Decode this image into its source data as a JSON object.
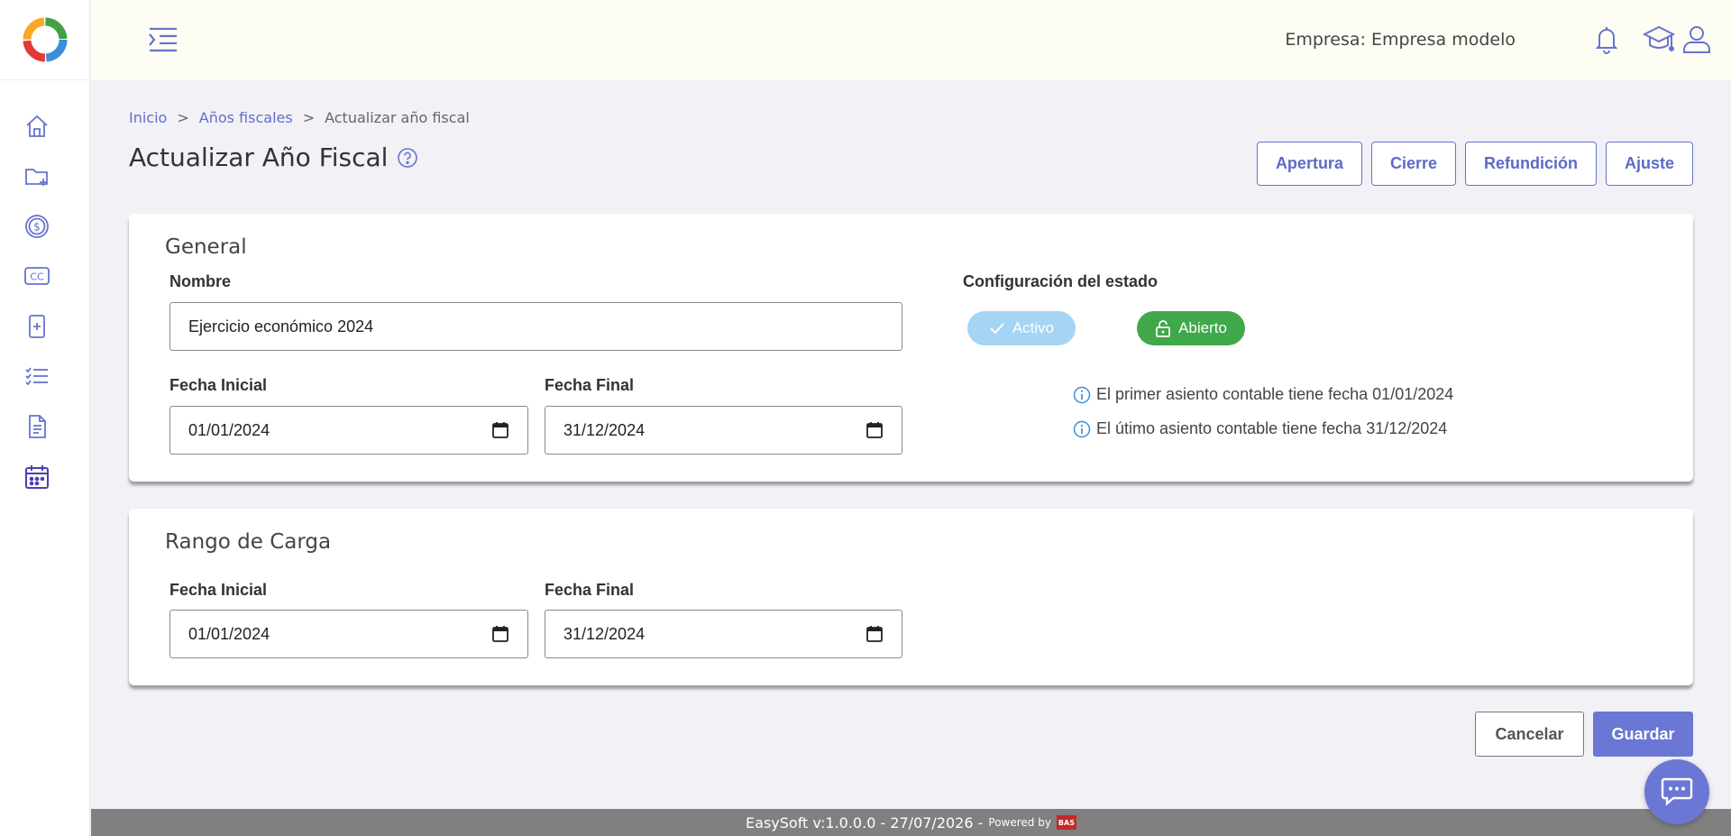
{
  "colors": {
    "accent": "#6574cd",
    "activo_pill": "#a5d4f5",
    "abierto_pill": "#3fa84a",
    "footer": "#808080"
  },
  "header": {
    "company": "Empresa: Empresa modelo"
  },
  "sidebar": {
    "icons": [
      "home-icon",
      "folder-plus-icon",
      "dollar-icon",
      "cc-icon",
      "document-plus-icon",
      "checklist-icon",
      "file-text-icon",
      "calendar-icon"
    ]
  },
  "breadcrumb": {
    "items": [
      "Inicio",
      "Años fiscales",
      "Actualizar año fiscal"
    ],
    "separator": ">"
  },
  "page": {
    "title": "Actualizar Año Fiscal"
  },
  "actions": {
    "apertura": "Apertura",
    "cierre": "Cierre",
    "refundicion": "Refundición",
    "ajuste": "Ajuste"
  },
  "general": {
    "title": "General",
    "nombre_label": "Nombre",
    "nombre_value": "Ejercicio económico 2024",
    "fecha_inicial_label": "Fecha Inicial",
    "fecha_inicial_value": "01/01/2024",
    "fecha_final_label": "Fecha Final",
    "fecha_final_value": "31/12/2024",
    "status_label": "Configuración del estado",
    "activo_label": "Activo",
    "abierto_label": "Abierto",
    "info_first": "El primer asiento contable tiene fecha 01/01/2024",
    "info_last": "El útimo asiento contable tiene fecha 31/12/2024"
  },
  "rango": {
    "title": "Rango de Carga",
    "fecha_inicial_label": "Fecha Inicial",
    "fecha_inicial_value": "01/01/2024",
    "fecha_final_label": "Fecha Final",
    "fecha_final_value": "31/12/2024"
  },
  "form": {
    "cancel": "Cancelar",
    "save": "Guardar"
  },
  "footer": {
    "version": "EasySoft v:1.0.0.0 - 27/07/2026 -",
    "powered": "Powered by",
    "logo": "BAS"
  }
}
